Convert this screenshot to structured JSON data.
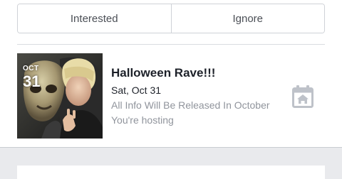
{
  "actions": {
    "interested_label": "Interested",
    "ignore_label": "Ignore"
  },
  "event": {
    "date_badge": {
      "month": "OCT",
      "day": "31"
    },
    "title": "Halloween Rave!!!",
    "date": "Sat, Oct 31",
    "description": "All Info Will Be Released In October",
    "status": "You're hosting",
    "icon": "calendar-house-icon"
  },
  "colors": {
    "background": "#e9eaed",
    "card": "#ffffff",
    "primary_text": "#1d2129",
    "secondary_text": "#90949c",
    "icon": "#bec2c9"
  }
}
